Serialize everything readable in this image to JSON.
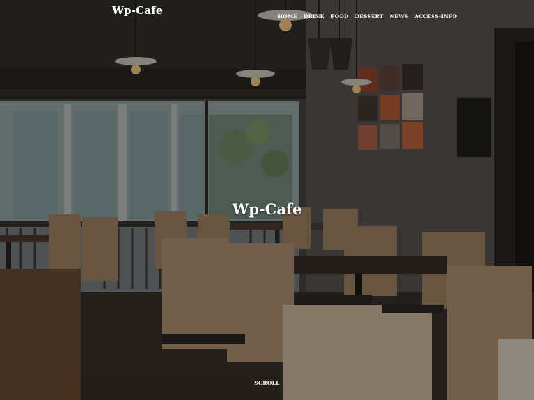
{
  "site": {
    "logo": "Wp-Cafe"
  },
  "nav": {
    "items": [
      {
        "label": "HOME"
      },
      {
        "label": "DRINK"
      },
      {
        "label": "FOOD"
      },
      {
        "label": "DESSERT"
      },
      {
        "label": "NEWS"
      },
      {
        "label": "ACCESS-INFO"
      }
    ]
  },
  "hero": {
    "title": "Wp-Cafe",
    "scroll_label": "SCROLL"
  },
  "colors": {
    "text": "#ffffff",
    "wall": "#5c5853",
    "wood": "#a07c5a"
  }
}
